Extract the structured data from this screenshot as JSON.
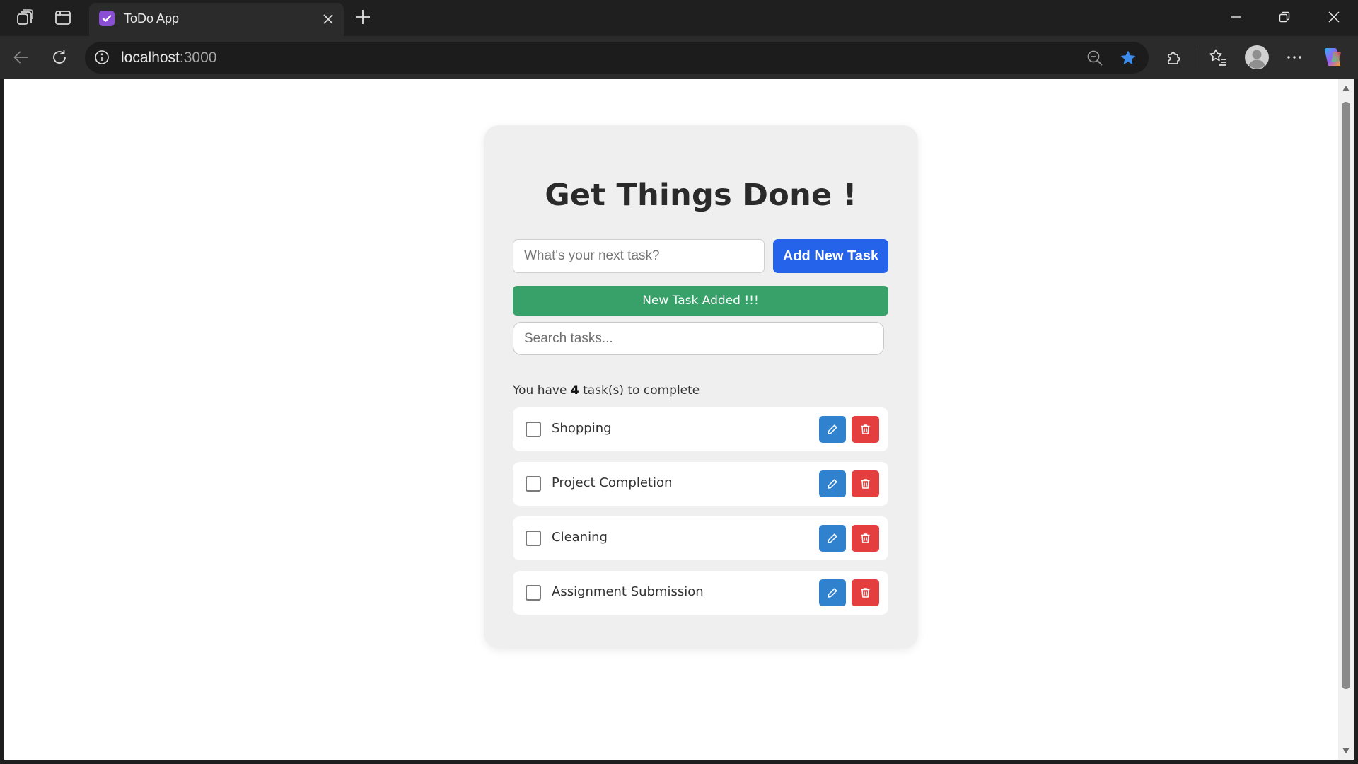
{
  "browser": {
    "tab_title": "ToDo App",
    "address_host": "localhost",
    "address_port": ":3000",
    "colors": {
      "favicon": "#8b4fd6",
      "star": "#3b8ced"
    },
    "icons": [
      "workspaces-icon",
      "tab-actions-icon",
      "todo-favicon-icon",
      "close-icon",
      "plus-icon",
      "minimize-icon",
      "restore-icon",
      "close-window-icon",
      "back-icon",
      "refresh-icon",
      "info-icon",
      "zoom-out-icon",
      "favorite-star-icon",
      "extensions-icon",
      "favorites-icon",
      "profile-icon",
      "more-icon",
      "copilot-icon"
    ]
  },
  "app": {
    "title": "Get Things Done !",
    "task_input_placeholder": "What's your next task?",
    "add_button_label": "Add New Task",
    "notice": "New Task Added !!!",
    "search_placeholder": "Search tasks...",
    "summary_prefix": "You have ",
    "summary_count": "4",
    "summary_suffix": " task(s) to complete",
    "tasks": [
      {
        "label": "Shopping"
      },
      {
        "label": "Project Completion"
      },
      {
        "label": "Cleaning"
      },
      {
        "label": "Assignment Submission"
      }
    ],
    "colors": {
      "card_bg": "#efefef",
      "add_button": "#2563eb",
      "notice_bg": "#38a169",
      "edit_button": "#3182ce",
      "delete_button": "#e53e3e"
    }
  }
}
